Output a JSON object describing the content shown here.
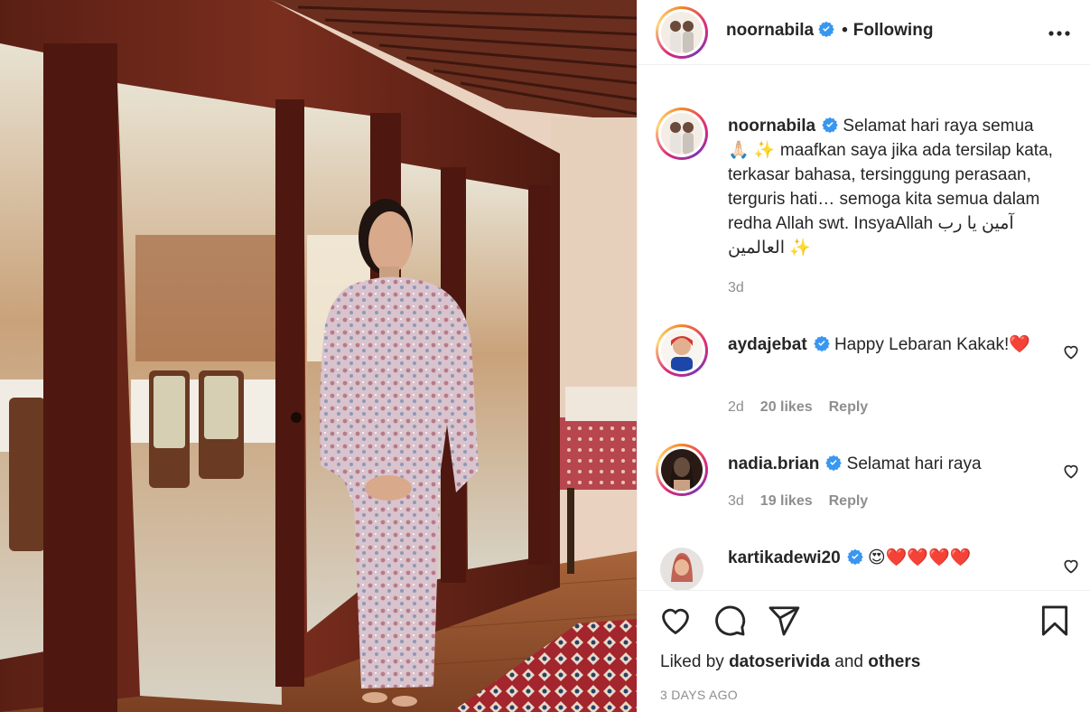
{
  "post": {
    "username": "noornabila",
    "follow_separator": "•",
    "follow_label": "Following",
    "more_icon": "more-options-icon"
  },
  "caption": {
    "username": "noornabila",
    "text_line1": "Selamat hari raya semua",
    "text_rest": "🙏🏻 ✨ maafkan saya jika ada tersilap kata, terkasar bahasa, tersinggung perasaan, terguris hati… semoga kita semua dalam redha Allah swt. InsyaAllah آمين يا رب العالمين ✨",
    "time": "3d"
  },
  "comments": [
    {
      "username": "aydajebat",
      "text": "Happy Lebaran Kakak!❤️",
      "time": "2d",
      "likes": "20 likes",
      "reply": "Reply"
    },
    {
      "username": "nadia.brian",
      "text": "Selamat hari raya",
      "time": "3d",
      "likes": "19 likes",
      "reply": "Reply"
    },
    {
      "username": "kartikadewi20",
      "text": "😍❤️❤️❤️❤️"
    }
  ],
  "footer": {
    "liked_prefix": "Liked by",
    "liked_user": "datoserivida",
    "liked_and": "and",
    "liked_others": "others",
    "timestamp": "3 DAYS AGO"
  },
  "colors": {
    "verified": "#3897f0",
    "text": "#262626",
    "muted": "#8e8e8e",
    "divider": "#efefef"
  }
}
